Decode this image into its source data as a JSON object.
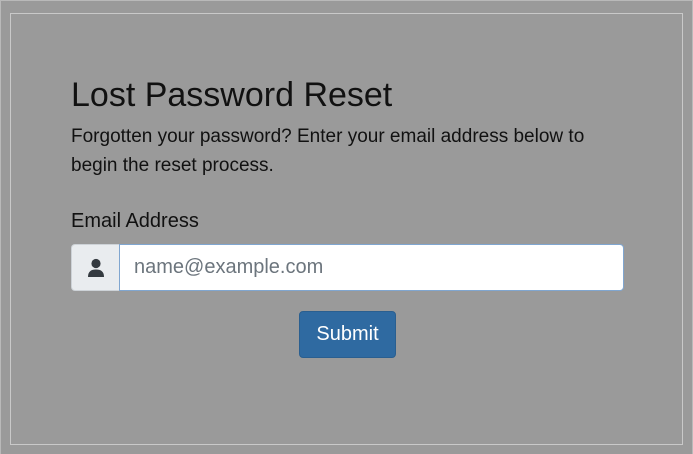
{
  "form": {
    "title": "Lost Password Reset",
    "description": "Forgotten your password? Enter your email address below to begin the reset process.",
    "email_label": "Email Address",
    "email_value": "",
    "email_placeholder": "name@example.com",
    "email_icon": "user-icon",
    "submit_label": "Submit"
  },
  "colors": {
    "page_background": "#9a9a9a",
    "button_primary": "#2f6aa1",
    "input_addon": "#e9ecef",
    "input_focus_border": "#80a6d0"
  }
}
